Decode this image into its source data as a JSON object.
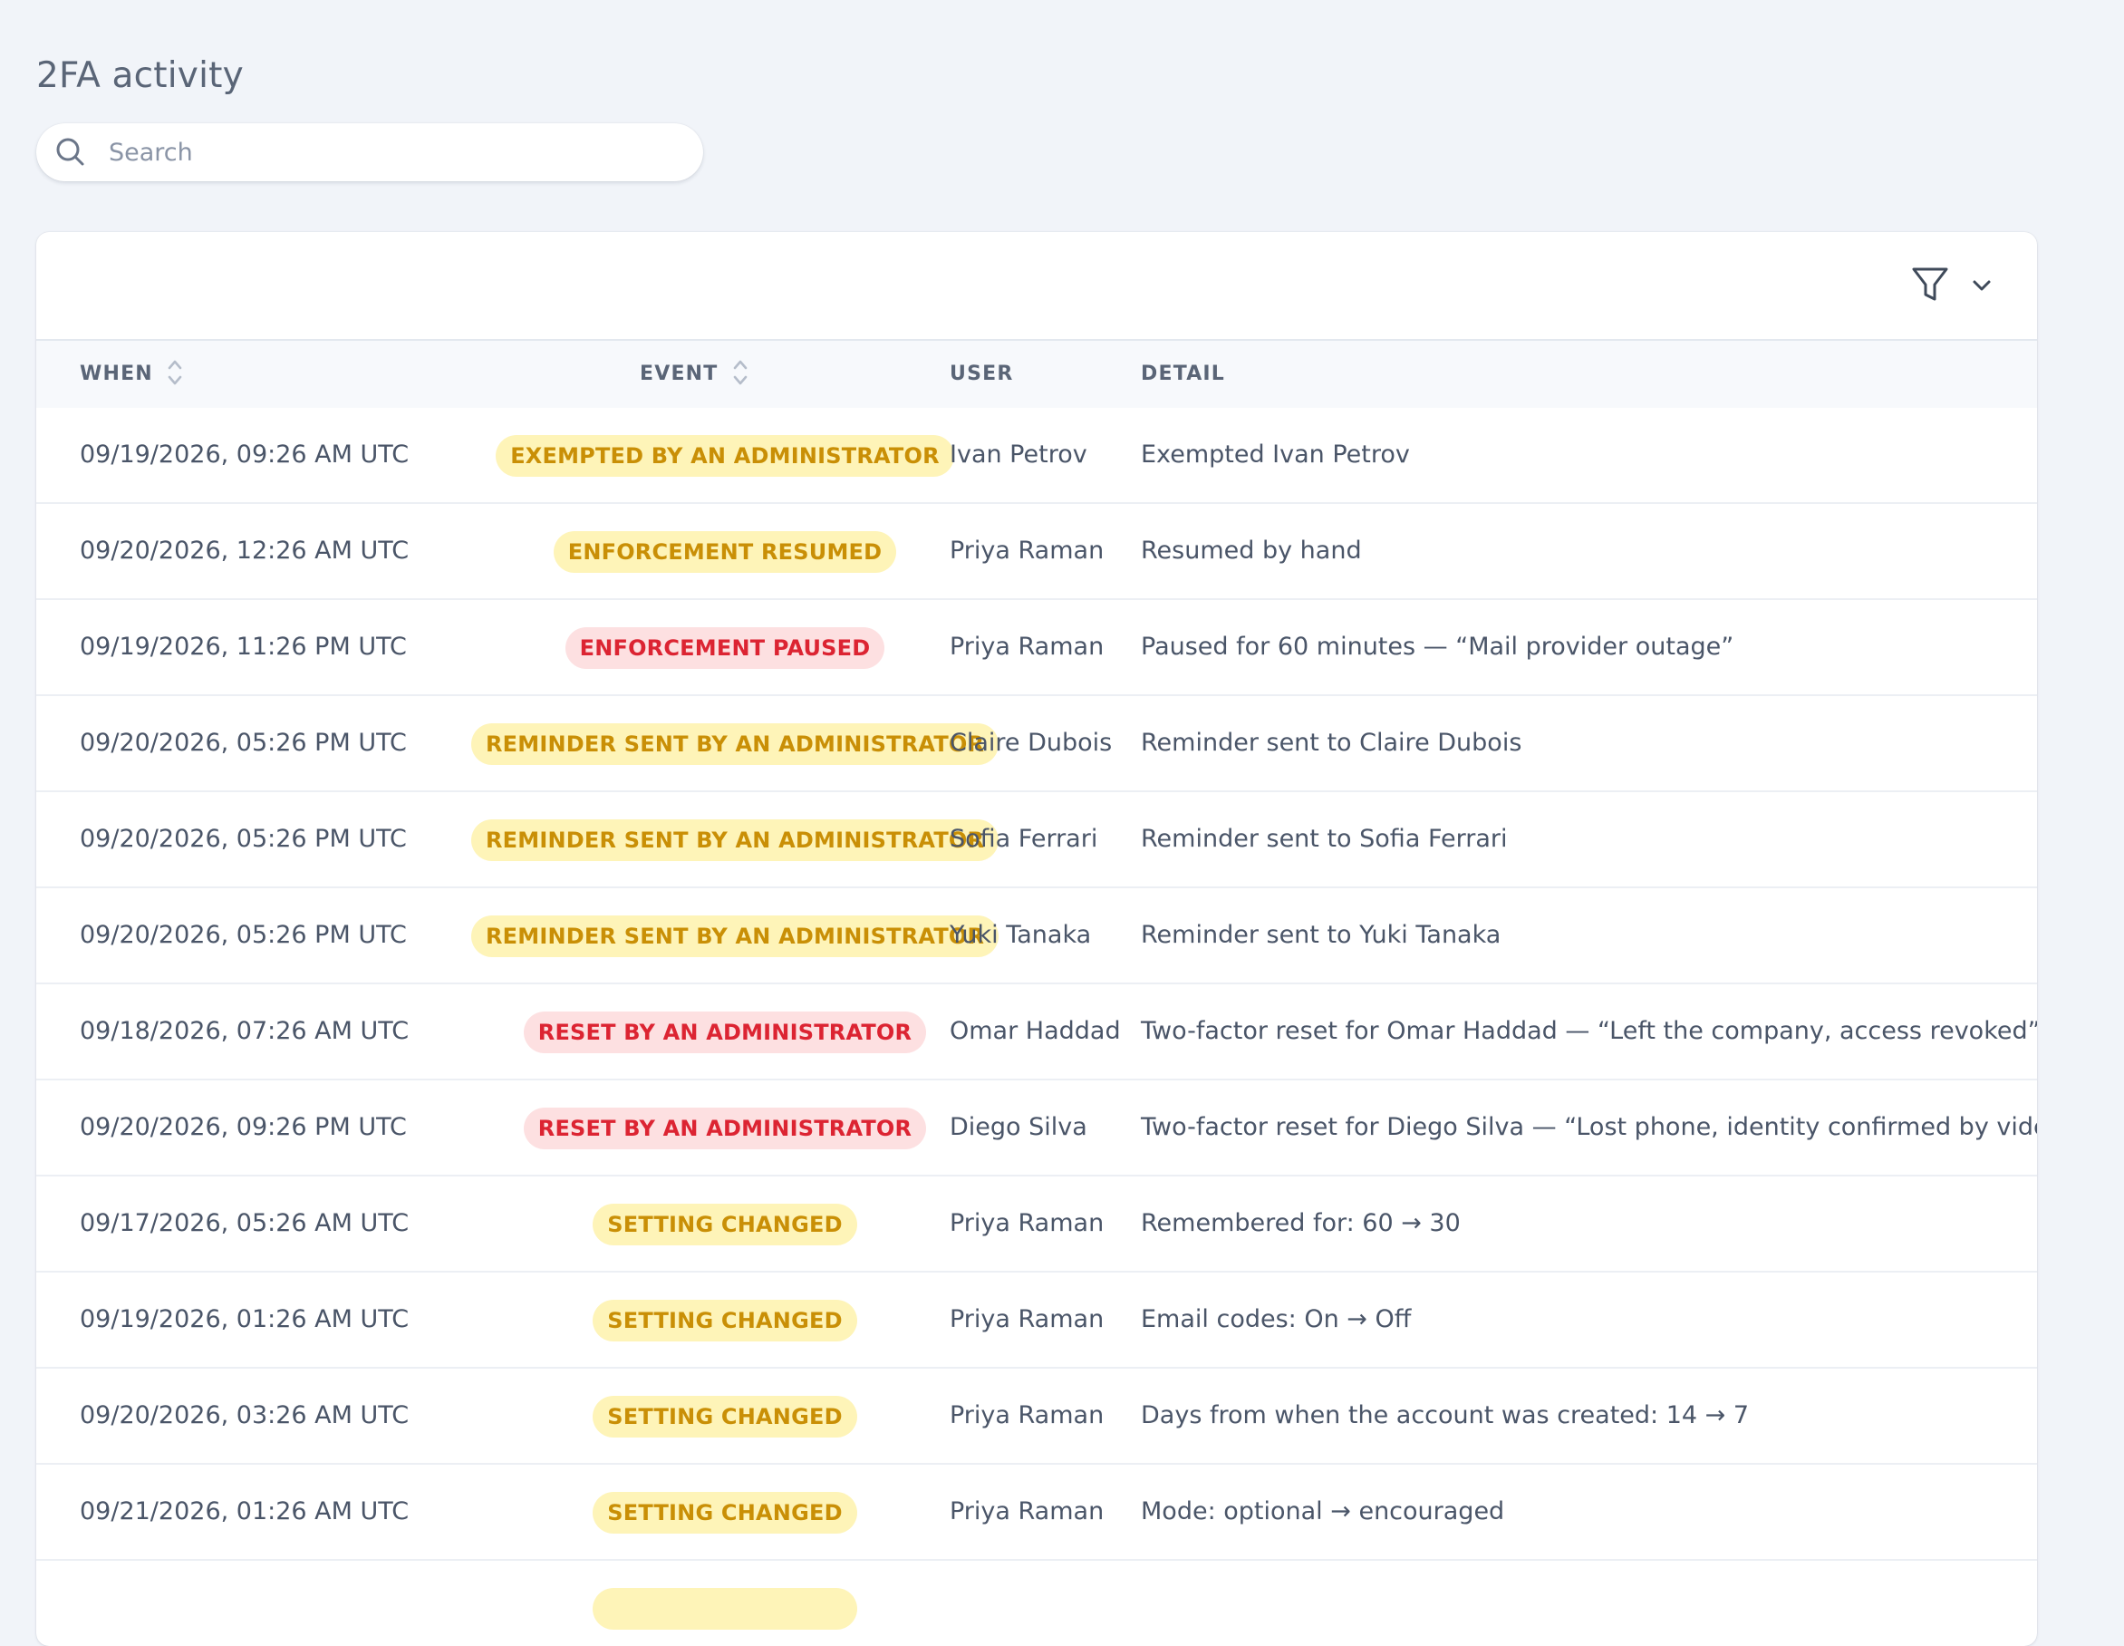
{
  "page": {
    "title": "2FA activity"
  },
  "search": {
    "placeholder": "Search",
    "value": ""
  },
  "colors": {
    "background": "#f1f4f9",
    "card": "#ffffff",
    "warning_bg": "#fef4b8",
    "warning_text": "#c98f06",
    "danger_bg": "#fde0e1",
    "danger_text": "#dc2432"
  },
  "toolbar": {
    "filter_icon": "filter-icon",
    "dropdown_icon": "chevron-down-icon"
  },
  "table": {
    "columns": {
      "when": "WHEN",
      "event": "EVENT",
      "user": "USER",
      "detail": "DETAIL"
    },
    "rows": [
      {
        "when": "09/19/2026, 09:26 AM UTC",
        "event": "EXEMPTED BY AN ADMINISTRATOR",
        "event_status": "warning",
        "user": "Ivan Petrov",
        "detail": "Exempted Ivan Petrov"
      },
      {
        "when": "09/20/2026, 12:26 AM UTC",
        "event": "ENFORCEMENT RESUMED",
        "event_status": "warning",
        "user": "Priya Raman",
        "detail": "Resumed by hand"
      },
      {
        "when": "09/19/2026, 11:26 PM UTC",
        "event": "ENFORCEMENT PAUSED",
        "event_status": "danger",
        "user": "Priya Raman",
        "detail": "Paused for 60 minutes — “Mail provider outage”"
      },
      {
        "when": "09/20/2026, 05:26 PM UTC",
        "event": "REMINDER SENT BY AN ADMINISTRATOR",
        "event_status": "warning",
        "user": "Claire Dubois",
        "detail": "Reminder sent to Claire Dubois"
      },
      {
        "when": "09/20/2026, 05:26 PM UTC",
        "event": "REMINDER SENT BY AN ADMINISTRATOR",
        "event_status": "warning",
        "user": "Sofia Ferrari",
        "detail": "Reminder sent to Sofia Ferrari"
      },
      {
        "when": "09/20/2026, 05:26 PM UTC",
        "event": "REMINDER SENT BY AN ADMINISTRATOR",
        "event_status": "warning",
        "user": "Yuki Tanaka",
        "detail": "Reminder sent to Yuki Tanaka"
      },
      {
        "when": "09/18/2026, 07:26 AM UTC",
        "event": "RESET BY AN ADMINISTRATOR",
        "event_status": "danger",
        "user": "Omar Haddad",
        "detail": "Two-factor reset for Omar Haddad — “Left the company, access revoked”"
      },
      {
        "when": "09/20/2026, 09:26 PM UTC",
        "event": "RESET BY AN ADMINISTRATOR",
        "event_status": "danger",
        "user": "Diego Silva",
        "detail": "Two-factor reset for Diego Silva — “Lost phone, identity confirmed by video ca"
      },
      {
        "when": "09/17/2026, 05:26 AM UTC",
        "event": "SETTING CHANGED",
        "event_status": "warning",
        "user": "Priya Raman",
        "detail": "Remembered for: 60 → 30"
      },
      {
        "when": "09/19/2026, 01:26 AM UTC",
        "event": "SETTING CHANGED",
        "event_status": "warning",
        "user": "Priya Raman",
        "detail": "Email codes: On → Off"
      },
      {
        "when": "09/20/2026, 03:26 AM UTC",
        "event": "SETTING CHANGED",
        "event_status": "warning",
        "user": "Priya Raman",
        "detail": "Days from when the account was created: 14 → 7"
      },
      {
        "when": "09/21/2026, 01:26 AM UTC",
        "event": "SETTING CHANGED",
        "event_status": "warning",
        "user": "Priya Raman",
        "detail": "Mode: optional → encouraged"
      },
      {
        "when": "",
        "event": "",
        "event_status": "warning",
        "user": "",
        "detail": ""
      }
    ]
  }
}
